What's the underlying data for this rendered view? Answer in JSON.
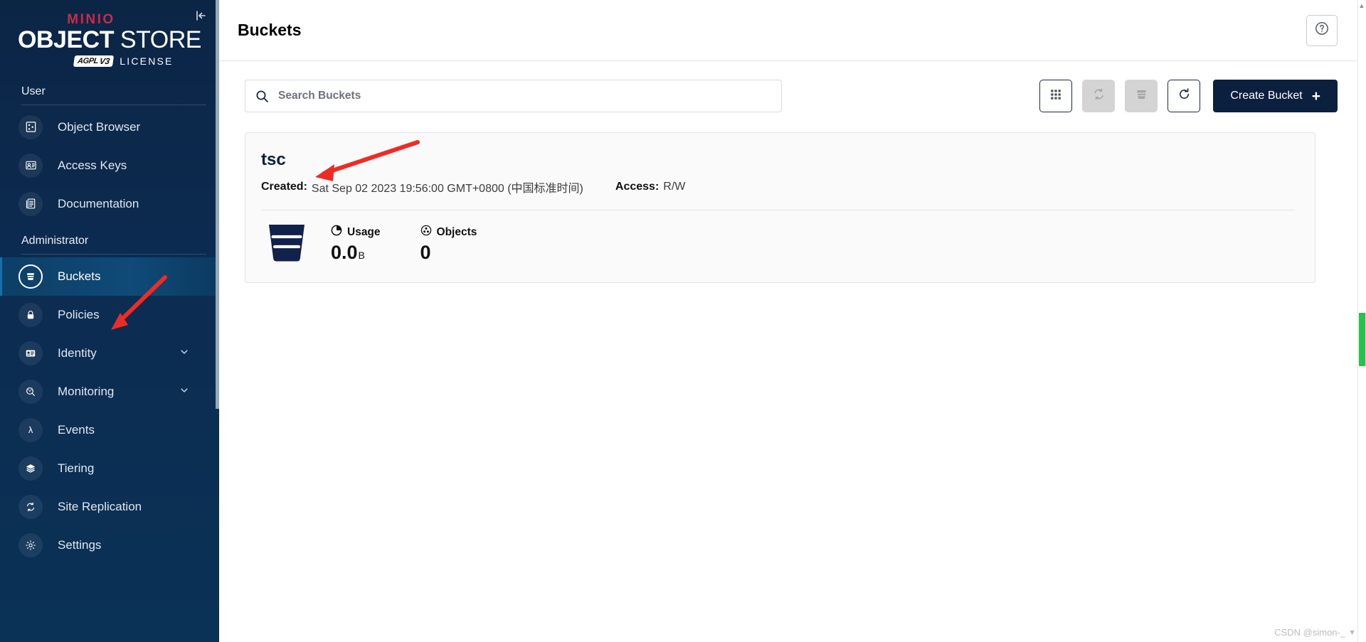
{
  "sidebar": {
    "logo": {
      "brand": "MINIO",
      "title_bold": "OBJECT",
      "title_light": " STORE",
      "license_badge": "AGPL",
      "license_badge_version": "V3",
      "license_text": "LICENSE",
      "collapse_icon": "collapse-left-icon"
    },
    "sections": [
      {
        "label": "User",
        "items": [
          {
            "label": "Object Browser",
            "icon": "object-browser-icon",
            "active": false,
            "expandable": false
          },
          {
            "label": "Access Keys",
            "icon": "access-keys-icon",
            "active": false,
            "expandable": false
          },
          {
            "label": "Documentation",
            "icon": "documentation-icon",
            "active": false,
            "expandable": false
          }
        ]
      },
      {
        "label": "Administrator",
        "items": [
          {
            "label": "Buckets",
            "icon": "bucket-icon",
            "active": true,
            "expandable": false
          },
          {
            "label": "Policies",
            "icon": "lock-icon",
            "active": false,
            "expandable": false
          },
          {
            "label": "Identity",
            "icon": "identity-card-icon",
            "active": false,
            "expandable": true
          },
          {
            "label": "Monitoring",
            "icon": "monitoring-search-icon",
            "active": false,
            "expandable": true
          },
          {
            "label": "Events",
            "icon": "lambda-icon",
            "active": false,
            "expandable": false
          },
          {
            "label": "Tiering",
            "icon": "layers-icon",
            "active": false,
            "expandable": false
          },
          {
            "label": "Site Replication",
            "icon": "replication-icon",
            "active": false,
            "expandable": false
          },
          {
            "label": "Settings",
            "icon": "gear-icon",
            "active": false,
            "expandable": false
          }
        ]
      }
    ]
  },
  "header": {
    "title": "Buckets",
    "help_icon": "help-circle-icon"
  },
  "toolbar": {
    "search_placeholder": "Search Buckets",
    "search_value": "",
    "search_icon": "search-icon",
    "buttons": [
      {
        "name": "grid-view-button",
        "icon": "grid-icon",
        "disabled": false
      },
      {
        "name": "replication-button",
        "icon": "replication-icon",
        "disabled": true
      },
      {
        "name": "delete-bucket-button",
        "icon": "bucket-delete-icon",
        "disabled": true
      },
      {
        "name": "refresh-button",
        "icon": "refresh-icon",
        "disabled": false
      }
    ],
    "create_label": "Create Bucket",
    "create_plus": "+"
  },
  "buckets": [
    {
      "name": "tsc",
      "created_label": "Created:",
      "created_value": "Sat Sep 02 2023 19:56:00 GMT+0800 (中国标准时间)",
      "access_label": "Access:",
      "access_value": "R/W",
      "usage_label": "Usage",
      "usage_value": "0.0",
      "usage_unit": "B",
      "objects_label": "Objects",
      "objects_value": "0"
    }
  ],
  "watermark": {
    "text": "CSDN @simon-_"
  },
  "colors": {
    "sidebar_bg": "#0b2545",
    "brand_red": "#c72c48",
    "accent_navy": "#0b1f3f",
    "active_nav": "#0f4a78",
    "scrollbar_green": "#27c24c",
    "annotation_red": "#ee2b24"
  }
}
